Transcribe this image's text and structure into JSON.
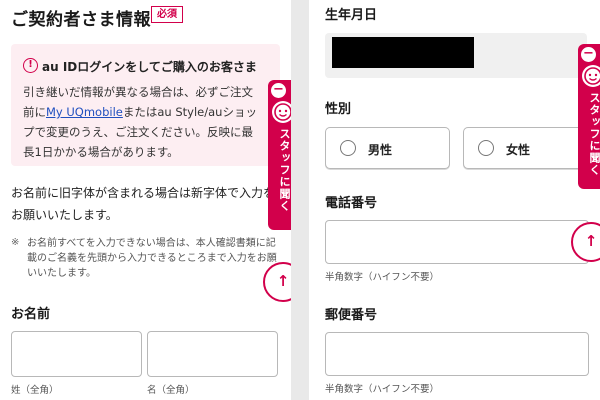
{
  "left": {
    "section_title": "ご契約者さま情報",
    "required_badge": "必須",
    "notice": {
      "icon": "exclamation-icon",
      "title": "au IDログインをしてご購入のお客さま",
      "line1": "引き継いだ情報が異なる場合は、必ずご注文",
      "pre_link": "前に",
      "link1": "My UQmobile",
      "mid_link": "またはau Style/auショッ",
      "line3": "プで変更のうえ、ご注文ください。反映に最",
      "line4": "長1日かかる場合があります。"
    },
    "lead_text": "お名前に旧字体が含まれる場合は新字体で入力をお願いいたします。",
    "note_mark": "※",
    "note_text": "お名前すべてを入力できない場合は、本人確認書類に記載のご名義を先頭から入力できるところまで入力をお願いいたします。",
    "name_label": "お名前",
    "last_name_hint": "姓（全角）",
    "first_name_hint": "名（全角）"
  },
  "right": {
    "dob_label": "生年月日",
    "gender_label": "性別",
    "male_label": "男性",
    "female_label": "女性",
    "phone_label": "電話番号",
    "phone_hint": "半角数字（ハイフン不要）",
    "postal_label": "郵便番号",
    "postal_hint": "半角数字（ハイフン不要）"
  },
  "staff_tab": {
    "text": "スタッフに聞く",
    "close_symbol": "−",
    "icon": "staff-face-icon"
  },
  "scroll_top": {
    "symbol": "↑",
    "icon": "arrow-up-icon"
  },
  "colors": {
    "accent": "#d2004b",
    "notice_bg": "#fdeef2",
    "link": "#1f4fbf"
  }
}
